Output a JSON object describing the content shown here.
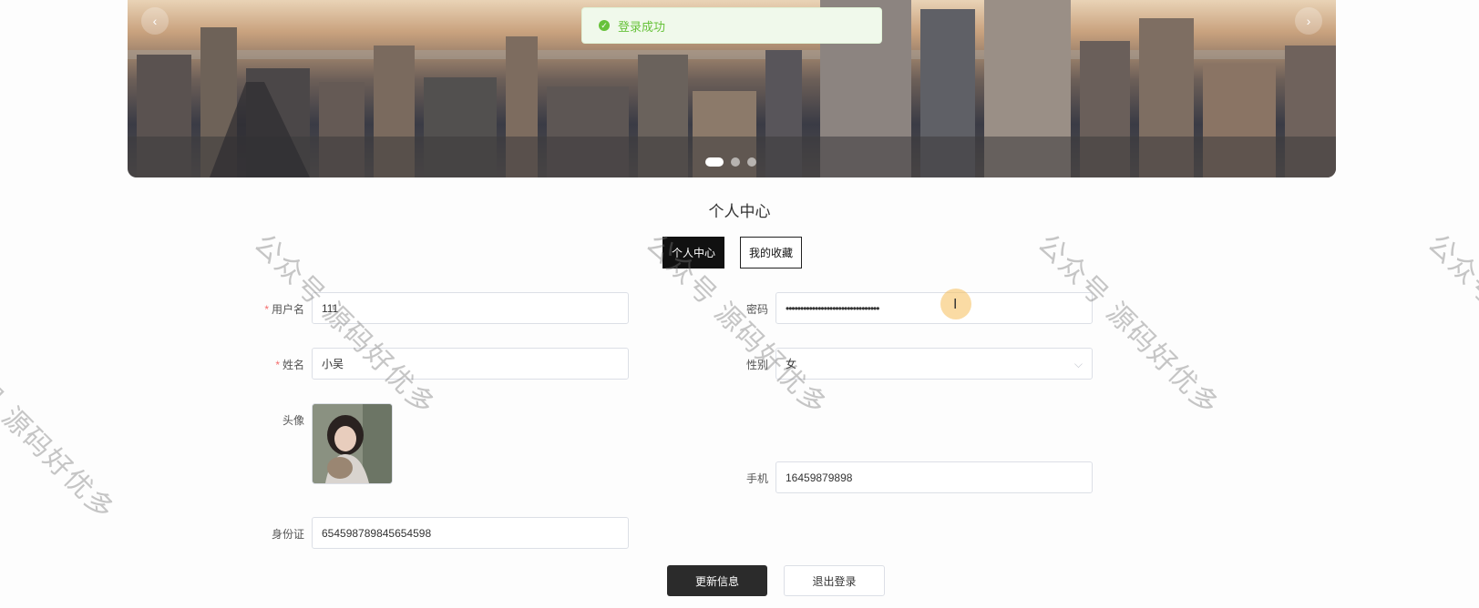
{
  "toast": {
    "message": "登录成功",
    "icon": "check-circle-icon",
    "color": "#67c23a"
  },
  "carousel": {
    "prev": "‹",
    "next": "›",
    "slides": 3,
    "active_slide": 1
  },
  "page_title": "个人中心",
  "tabs": {
    "profile": "个人中心",
    "favorites": "我的收藏"
  },
  "form": {
    "username": {
      "label": "用户名",
      "required": true,
      "value": "111"
    },
    "password": {
      "label": "密码",
      "value": "••••••••••••••••••••••••••••••••"
    },
    "name": {
      "label": "姓名",
      "required": true,
      "value": "小吴"
    },
    "gender": {
      "label": "性别",
      "value": "女"
    },
    "avatar": {
      "label": "头像"
    },
    "phone": {
      "label": "手机",
      "value": "16459879898"
    },
    "id_card": {
      "label": "身份证",
      "value": "654598789845654598"
    }
  },
  "actions": {
    "update": "更新信息",
    "logout": "退出登录"
  },
  "watermark": "公众号 源码好优多",
  "colors": {
    "primary_dark": "#111111",
    "required": "#f56c6c",
    "success": "#67c23a"
  }
}
